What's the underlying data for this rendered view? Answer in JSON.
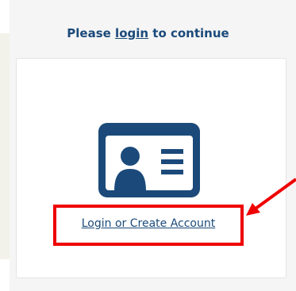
{
  "heading": {
    "prefix": "Please ",
    "link": "login",
    "suffix": " to continue"
  },
  "account": {
    "link_label": "Login or Create Account"
  },
  "icons": {
    "id_card": "id-card-icon",
    "arrow": "annotation-arrow-icon"
  },
  "colors": {
    "link": "#1b4a7a",
    "annotation": "#ee0000"
  }
}
